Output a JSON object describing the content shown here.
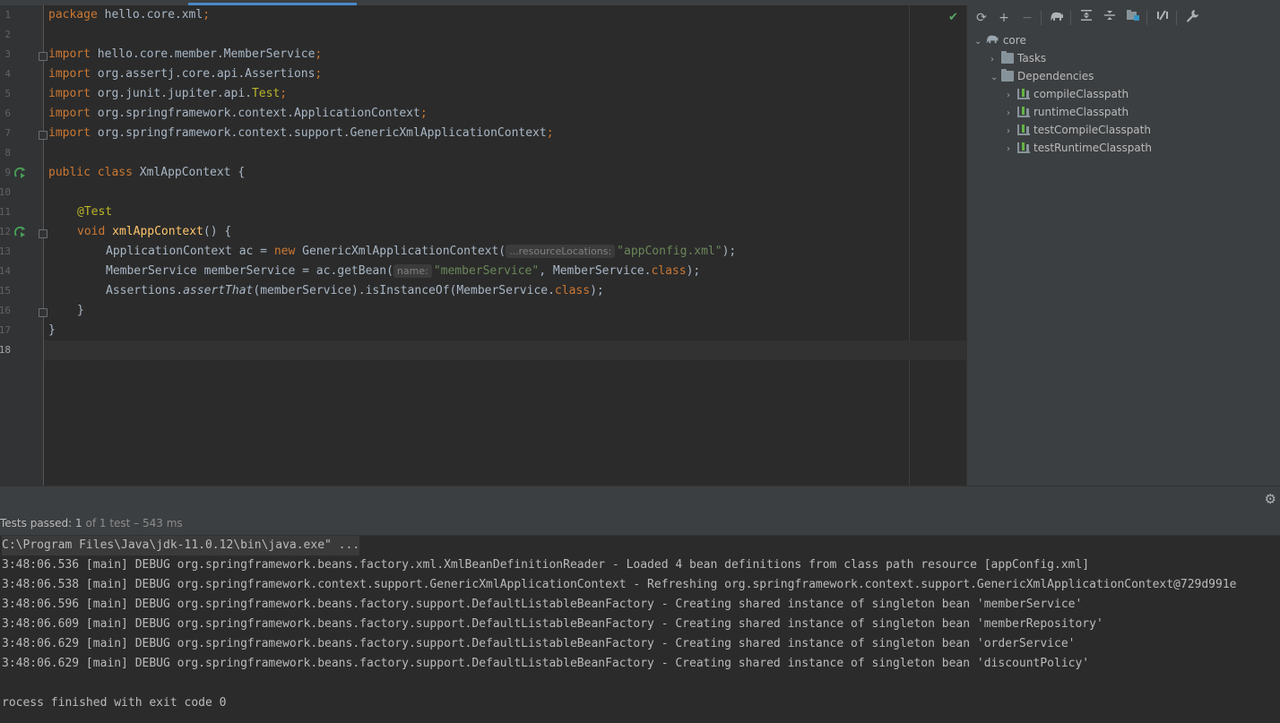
{
  "editor": {
    "lines": [
      {
        "num": "1"
      },
      {
        "num": "2"
      },
      {
        "num": "3"
      },
      {
        "num": "4"
      },
      {
        "num": "5"
      },
      {
        "num": "6"
      },
      {
        "num": "7"
      },
      {
        "num": "8"
      },
      {
        "num": "9"
      },
      {
        "num": "10"
      },
      {
        "num": "11"
      },
      {
        "num": "12"
      },
      {
        "num": "13"
      },
      {
        "num": "14"
      },
      {
        "num": "15"
      },
      {
        "num": "16"
      },
      {
        "num": "17"
      },
      {
        "num": "18"
      }
    ],
    "code": {
      "l1": {
        "kw": "package",
        "rest": " hello.core.xml",
        "semi": ";"
      },
      "l3": {
        "kw": "import",
        "rest": " hello.core.member.MemberService",
        "semi": ";"
      },
      "l4": {
        "kw": "import",
        "rest": " org.assertj.core.api.Assertions",
        "semi": ";"
      },
      "l5": {
        "kw": "import",
        "rest": " org.junit.jupiter.api.",
        "ann": "Test",
        "semi": ";"
      },
      "l6": {
        "kw": "import",
        "rest": " org.springframework.context.ApplicationContext",
        "semi": ";"
      },
      "l7": {
        "kw": "import",
        "rest": " org.springframework.context.support.GenericXmlApplicationContext",
        "semi": ";"
      },
      "l9": {
        "kw1": "public",
        "kw2": "class",
        "rest": " XmlAppContext {"
      },
      "l11": {
        "ann": "@Test"
      },
      "l12": {
        "kw": "void",
        "fn": "xmlAppContext",
        "rest": "() {"
      },
      "l13": {
        "a": "ApplicationContext ac = ",
        "kw": "new",
        "b": " GenericXmlApplicationContext(",
        "hint": "...resourceLocations:",
        "str": "\"appConfig.xml\"",
        "c": ");"
      },
      "l14": {
        "a": "MemberService memberService = ac.getBean(",
        "hint": "name:",
        "str": "\"memberService\"",
        "b": ", MemberService.",
        "kw": "class",
        "c": ");"
      },
      "l15": {
        "a": "Assertions.",
        "it": "assertThat",
        "b": "(memberService).isInstanceOf(MemberService.",
        "kw": "class",
        "c": ");"
      },
      "l16": {
        "text": "}"
      },
      "l17": {
        "text": "}"
      }
    }
  },
  "gradle": {
    "toolbar": [
      "refresh-icon",
      "plus-icon",
      "minus-icon",
      "elephant-icon",
      "expand-all-icon",
      "collapse-all-icon",
      "dependencies-icon",
      "toggle-offline-icon",
      "wrench-icon"
    ],
    "tree": {
      "root": "core",
      "tasks": "Tasks",
      "dependencies": "Dependencies",
      "children": [
        "compileClasspath",
        "runtimeClasspath",
        "testCompileClasspath",
        "testRuntimeClasspath"
      ]
    }
  },
  "run": {
    "status_prefix": "Tests passed: ",
    "status_count": "1",
    "status_rest": " of 1 test – 543 ms",
    "console": [
      "C:\\Program Files\\Java\\jdk-11.0.12\\bin\\java.exe\" ...",
      "3:48:06.536 [main] DEBUG org.springframework.beans.factory.xml.XmlBeanDefinitionReader - Loaded 4 bean definitions from class path resource [appConfig.xml]",
      "3:48:06.538 [main] DEBUG org.springframework.context.support.GenericXmlApplicationContext - Refreshing org.springframework.context.support.GenericXmlApplicationContext@729d991e",
      "3:48:06.596 [main] DEBUG org.springframework.beans.factory.support.DefaultListableBeanFactory - Creating shared instance of singleton bean 'memberService'",
      "3:48:06.609 [main] DEBUG org.springframework.beans.factory.support.DefaultListableBeanFactory - Creating shared instance of singleton bean 'memberRepository'",
      "3:48:06.629 [main] DEBUG org.springframework.beans.factory.support.DefaultListableBeanFactory - Creating shared instance of singleton bean 'orderService'",
      "3:48:06.629 [main] DEBUG org.springframework.beans.factory.support.DefaultListableBeanFactory - Creating shared instance of singleton bean 'discountPolicy'",
      "",
      "rocess finished with exit code 0"
    ]
  },
  "colors": {
    "keyword": "#cc7832",
    "annotation": "#bbb529",
    "string": "#6a8759",
    "method": "#ffc66d",
    "run_icon": "#499c54"
  }
}
